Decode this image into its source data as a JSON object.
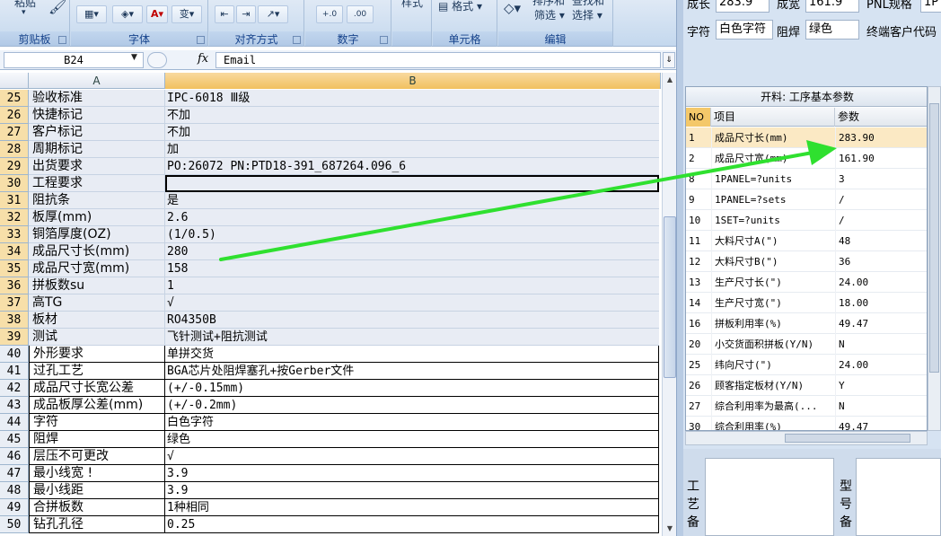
{
  "ribbon": {
    "groups": [
      {
        "title": "剪贴板"
      },
      {
        "title": "字体"
      },
      {
        "title": "对齐方式"
      },
      {
        "title": "数字"
      },
      {
        "title": ""
      },
      {
        "title": "单元格"
      },
      {
        "title": "编辑"
      }
    ],
    "clipboard_paste": "粘贴",
    "font_phonetic": "变",
    "number_format": "%",
    "styles_label": "样式",
    "format_label": "格式",
    "sort_filter_label": "筛选",
    "find_select_label": "选择",
    "sort_top": "排序和",
    "find_top": "查找和"
  },
  "formula_bar": {
    "name_box": "B24",
    "fx": "fx",
    "formula": "Email"
  },
  "columns": {
    "a": "A",
    "b": "B"
  },
  "rows": [
    {
      "n": "25",
      "a": "验收标准",
      "b": "IPC-6018 Ⅲ级"
    },
    {
      "n": "26",
      "a": "快捷标记",
      "b": "不加"
    },
    {
      "n": "27",
      "a": "客户标记",
      "b": "不加"
    },
    {
      "n": "28",
      "a": "周期标记",
      "b": "加"
    },
    {
      "n": "29",
      "a": "出货要求",
      "b": "PO:26072 PN:PTD18-391_687264.096_6"
    },
    {
      "n": "30",
      "a": "工程要求",
      "b": ""
    },
    {
      "n": "31",
      "a": "阻抗条",
      "b": "是"
    },
    {
      "n": "32",
      "a": "板厚(mm)",
      "b": "2.6"
    },
    {
      "n": "33",
      "a": "铜箔厚度(OZ)",
      "b": " (1/0.5)"
    },
    {
      "n": "34",
      "a": "成品尺寸长(mm)",
      "b": "280"
    },
    {
      "n": "35",
      "a": "成品尺寸宽(mm)",
      "b": "158"
    },
    {
      "n": "36",
      "a": "拼板数su",
      "b": "1"
    },
    {
      "n": "37",
      "a": "高TG",
      "b": "√"
    },
    {
      "n": "38",
      "a": "板材",
      "b": "RO4350B"
    },
    {
      "n": "39",
      "a": "测试",
      "b": "飞针测试+阻抗测试"
    },
    {
      "n": "40",
      "a": "外形要求",
      "b": "单拼交货"
    },
    {
      "n": "41",
      "a": "过孔工艺",
      "b": "BGA芯片处阻焊塞孔+按Gerber文件"
    },
    {
      "n": "42",
      "a": "成品尺寸长宽公差",
      "b": "(+/-0.15mm)"
    },
    {
      "n": "43",
      "a": "成品板厚公差(mm)",
      "b": "(+/-0.2mm)"
    },
    {
      "n": "44",
      "a": "字符",
      "b": "白色字符"
    },
    {
      "n": "45",
      "a": "阻焊",
      "b": "绿色"
    },
    {
      "n": "46",
      "a": "层压不可更改",
      "b": "√"
    },
    {
      "n": "47",
      "a": "最小线宽   !",
      "b": "3.9"
    },
    {
      "n": "48",
      "a": "最小线距",
      "b": "3.9"
    },
    {
      "n": "49",
      "a": "合拼板数",
      "b": "1种相同"
    },
    {
      "n": "50",
      "a": "钻孔孔径",
      "b": "0.25"
    }
  ],
  "right": {
    "top_fields": {
      "len_label": "成长",
      "len_value": "283.9",
      "wid_label": "成宽",
      "wid_value": "161.9",
      "pnl_label": "PNL规格",
      "pnl_value": "1P",
      "silk_label": "字符",
      "silk_value": "白色字符",
      "mask_label": "阻焊",
      "mask_value": "绿色",
      "customer_code_label": "终端客户代码"
    },
    "table": {
      "title": "开料: 工序基本参数",
      "head_no": "NO",
      "head_item": "项目",
      "head_param": "参数",
      "rows": [
        {
          "no": "1",
          "item": "成品尺寸长(mm)",
          "param": "283.90"
        },
        {
          "no": "2",
          "item": "成品尺寸宽(mm)",
          "param": "161.90"
        },
        {
          "no": "8",
          "item": "1PANEL=?units",
          "param": "3"
        },
        {
          "no": "9",
          "item": "1PANEL=?sets",
          "param": "/"
        },
        {
          "no": "10",
          "item": "1SET=?units",
          "param": "/"
        },
        {
          "no": "11",
          "item": "大料尺寸A(\")",
          "param": "48"
        },
        {
          "no": "12",
          "item": "大料尺寸B(\")",
          "param": "36"
        },
        {
          "no": "13",
          "item": "生产尺寸长(\")",
          "param": "24.00"
        },
        {
          "no": "14",
          "item": "生产尺寸宽(\")",
          "param": "18.00"
        },
        {
          "no": "16",
          "item": "拼板利用率(%)",
          "param": "49.47"
        },
        {
          "no": "20",
          "item": "小交货面积拼板(Y/N)",
          "param": "N"
        },
        {
          "no": "25",
          "item": "纬向尺寸(\")",
          "param": "24.00"
        },
        {
          "no": "26",
          "item": "顾客指定板材(Y/N)",
          "param": "Y"
        },
        {
          "no": "27",
          "item": "综合利用率为最高(...",
          "param": "N"
        },
        {
          "no": "30",
          "item": "综合利用率(%)",
          "param": "49.47"
        }
      ]
    },
    "lower": {
      "process_label": [
        "工",
        "艺",
        "备"
      ],
      "model_label": [
        "型",
        "号",
        "备"
      ]
    }
  },
  "colors": {
    "arrow": "#2fe02f",
    "selected_header": "#f1c15f",
    "row_header": "#f7dfa9"
  }
}
